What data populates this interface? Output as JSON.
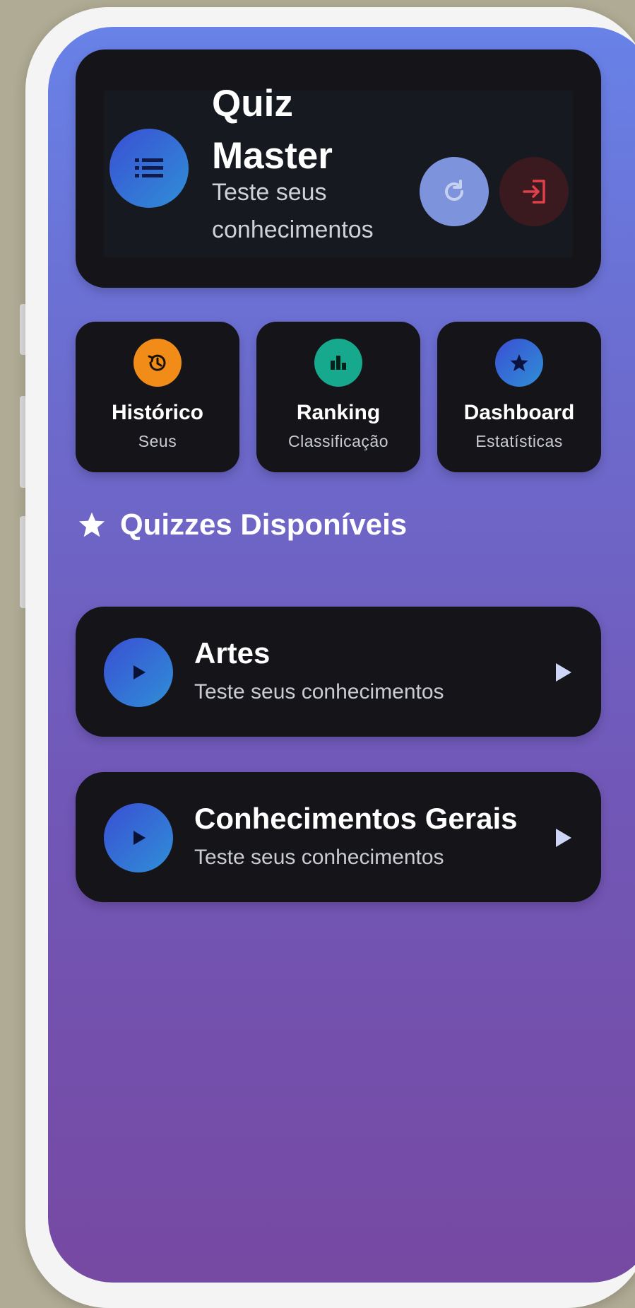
{
  "header": {
    "title_line1": "Quiz",
    "title_line2": "Master",
    "subtitle": "Teste seus conhecimentos",
    "menu_icon": "list-icon",
    "refresh_icon": "refresh-icon",
    "exit_icon": "logout-icon"
  },
  "tiles": [
    {
      "title": "Histórico",
      "subtitle": "Seus",
      "icon": "history-icon",
      "color": "#f28c18"
    },
    {
      "title": "Ranking",
      "subtitle": "Classificação",
      "icon": "bar-chart-icon",
      "color": "#17a98e"
    },
    {
      "title": "Dashboard",
      "subtitle": "Estatísticas",
      "icon": "star-icon",
      "color": "#2e6fd3"
    }
  ],
  "section": {
    "title": "Quizzes Disponíveis",
    "icon": "star-icon"
  },
  "quizzes": [
    {
      "title": "Artes",
      "subtitle": "Teste seus conhecimentos"
    },
    {
      "title": "Conhecimentos Gerais",
      "subtitle": "Teste seus conhecimentos"
    }
  ],
  "colors": {
    "accent_blue": "#3a4fd4",
    "refresh_bg": "#7d93dc",
    "exit_red": "#e0404a",
    "card_bg": "#141419"
  }
}
